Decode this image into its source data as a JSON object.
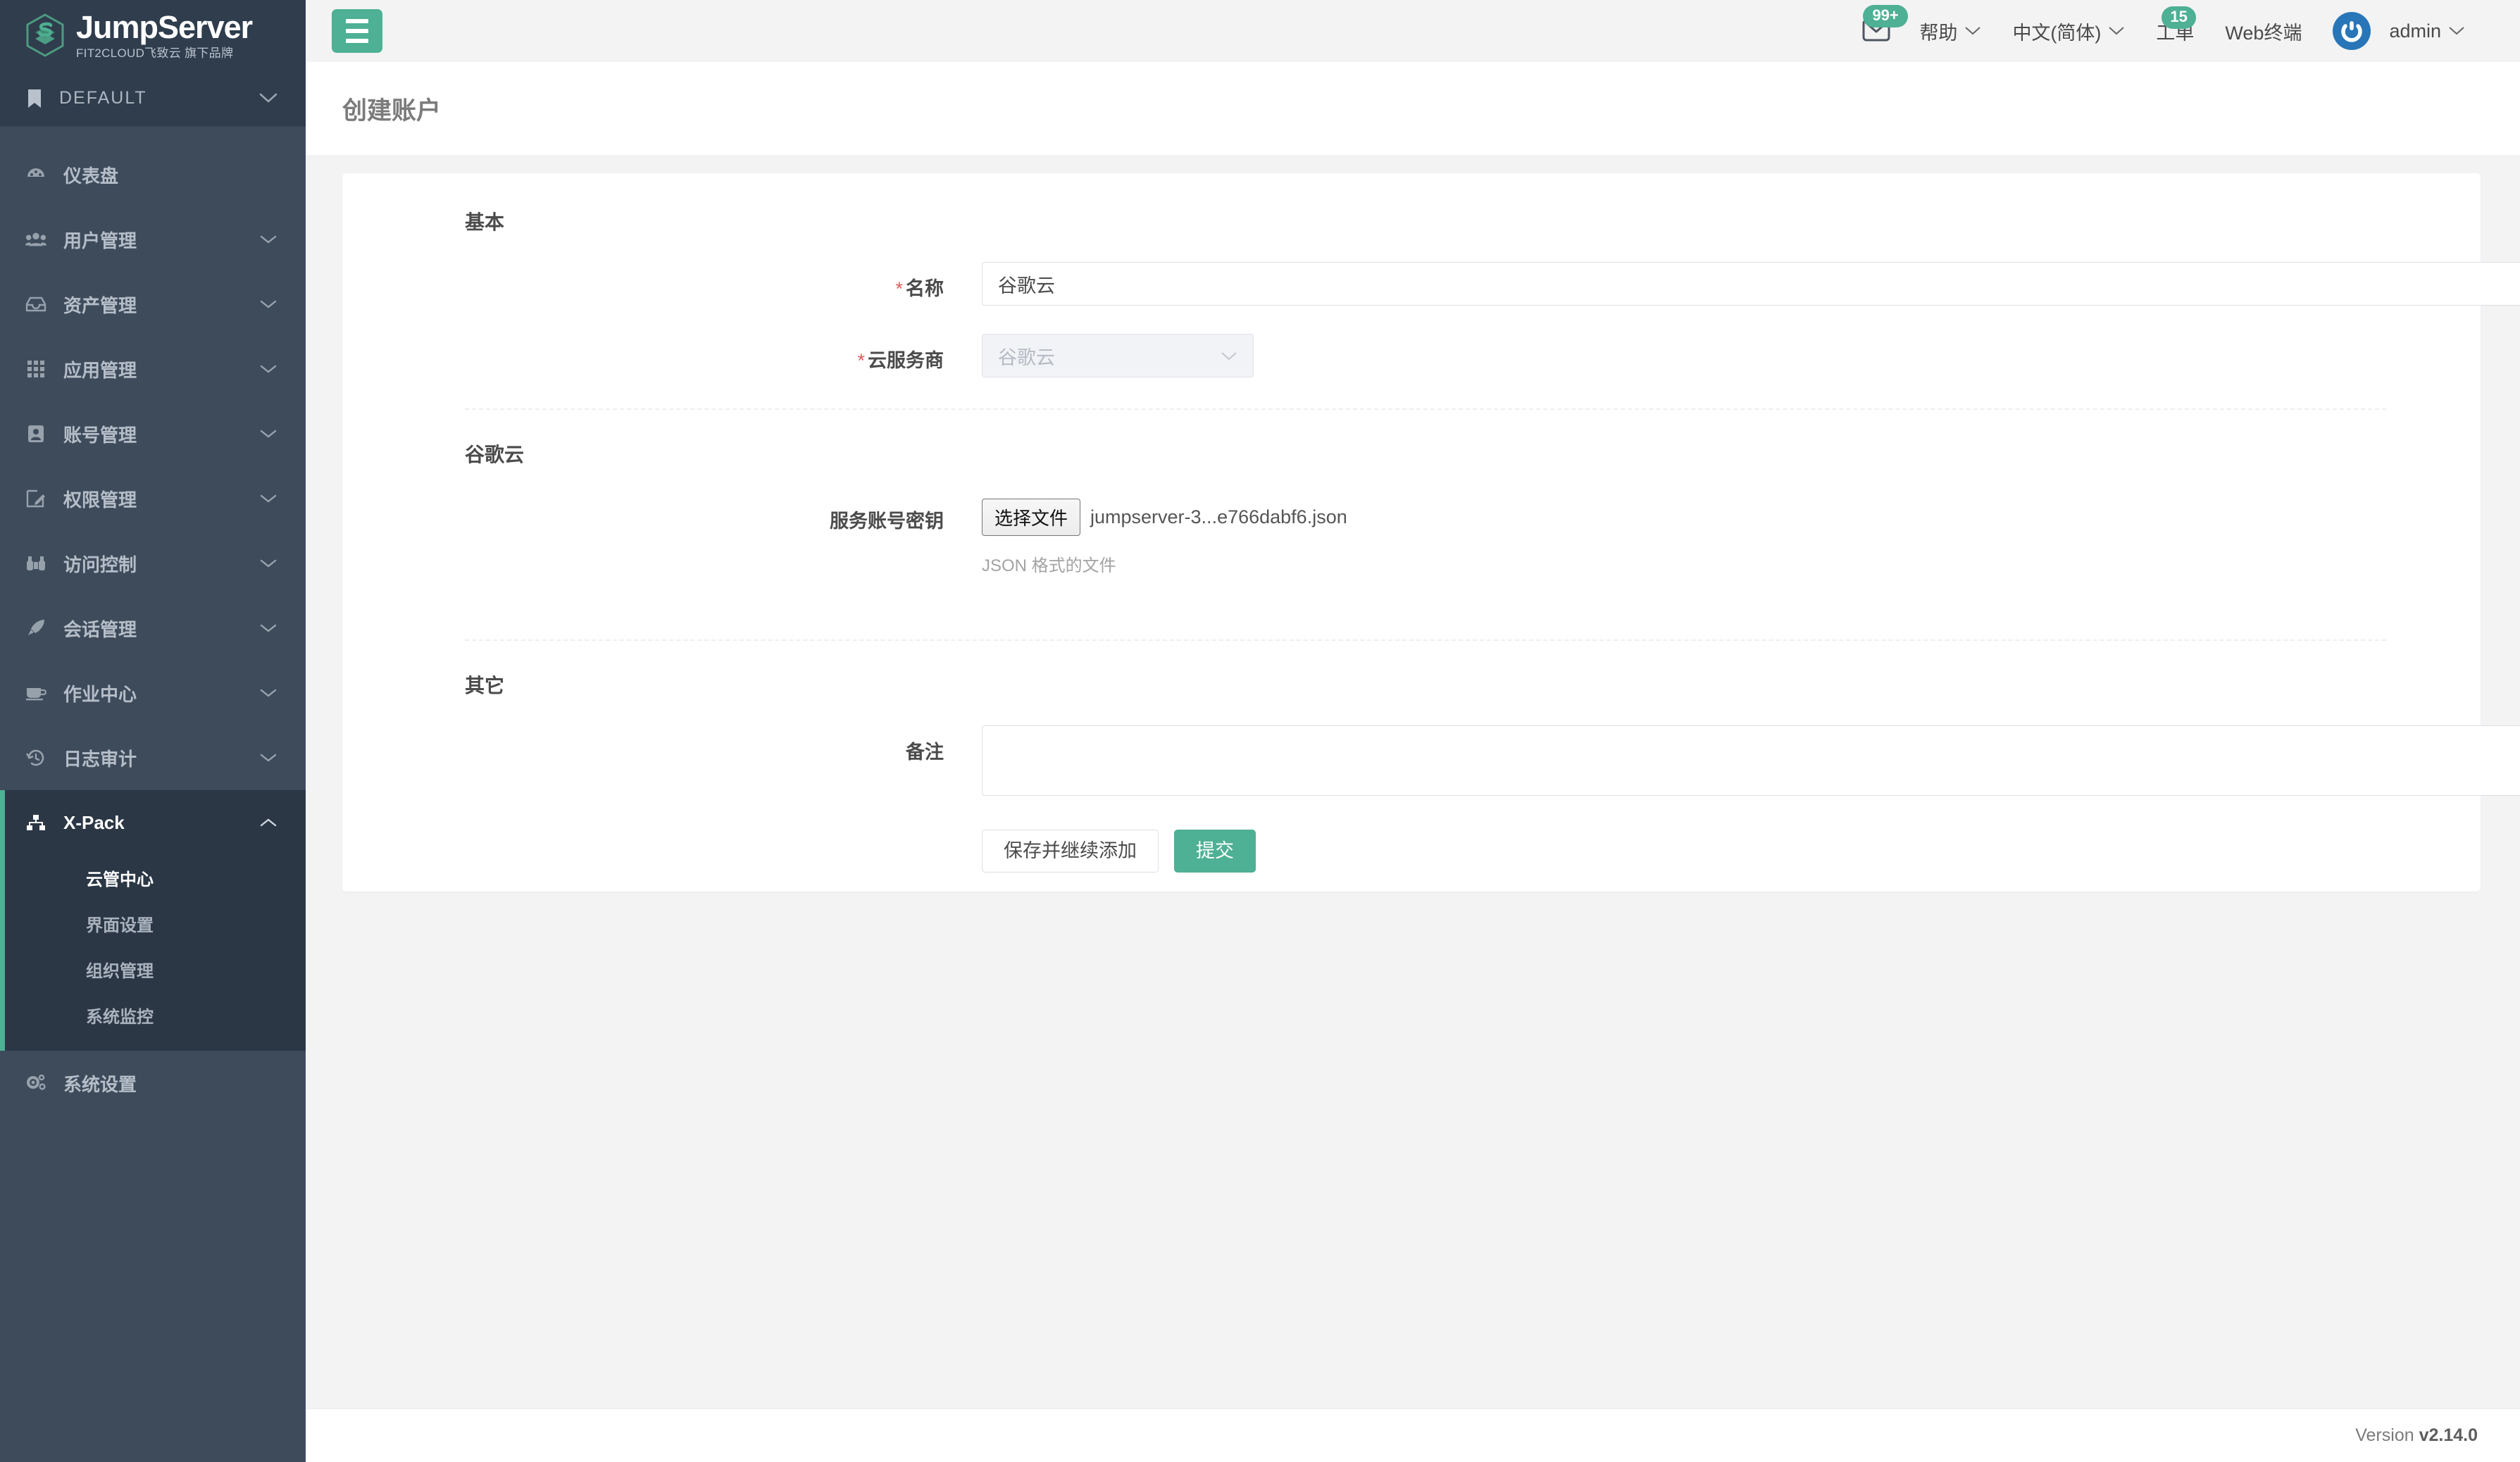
{
  "brand": {
    "name": "JumpServer",
    "subtitle": "FIT2CLOUD飞致云 旗下品牌",
    "logo_icon": "jumpserver-hexagon-logo"
  },
  "sidebar": {
    "org": {
      "label": "DEFAULT",
      "icon": "bookmark-icon",
      "caret": "chevron-down-icon"
    },
    "items": [
      {
        "label": "仪表盘",
        "icon": "dashboard-icon",
        "has_caret": false
      },
      {
        "label": "用户管理",
        "icon": "users-icon",
        "has_caret": true
      },
      {
        "label": "资产管理",
        "icon": "inbox-icon",
        "has_caret": true
      },
      {
        "label": "应用管理",
        "icon": "grid-icon",
        "has_caret": true
      },
      {
        "label": "账号管理",
        "icon": "id-card-icon",
        "has_caret": true
      },
      {
        "label": "权限管理",
        "icon": "edit-square-icon",
        "has_caret": true
      },
      {
        "label": "访问控制",
        "icon": "binoculars-icon",
        "has_caret": true
      },
      {
        "label": "会话管理",
        "icon": "rocket-icon",
        "has_caret": true
      },
      {
        "label": "作业中心",
        "icon": "coffee-icon",
        "has_caret": true
      }
    ],
    "audit": {
      "label": "日志审计",
      "icon": "history-icon",
      "has_caret": true
    },
    "xpack": {
      "label": "X-Pack",
      "icon": "sitemap-icon",
      "caret": "chevron-up-icon",
      "expanded": true,
      "sub_items": [
        {
          "label": "云管中心",
          "current": true
        },
        {
          "label": "界面设置",
          "current": false
        },
        {
          "label": "组织管理",
          "current": false
        },
        {
          "label": "系统监控",
          "current": false
        }
      ]
    },
    "settings": {
      "label": "系统设置",
      "icon": "gears-icon"
    }
  },
  "header": {
    "menu_toggle_icon": "hamburger-icon",
    "mail": {
      "icon": "envelope-icon",
      "badge": "99+"
    },
    "help": {
      "label": "帮助",
      "caret": "chevron-down-icon"
    },
    "language": {
      "label": "中文(简体)",
      "caret": "chevron-down-icon"
    },
    "ticket": {
      "label": "工单",
      "badge": "15"
    },
    "web_terminal": {
      "label": "Web终端"
    },
    "user": {
      "name": "admin",
      "avatar_icon": "power-avatar-icon",
      "caret": "chevron-down-icon"
    }
  },
  "page": {
    "title": "创建账户"
  },
  "form": {
    "basic": {
      "section_title": "基本",
      "name": {
        "label": "名称",
        "required": true,
        "value": "谷歌云",
        "placeholder": ""
      },
      "provider": {
        "label": "云服务商",
        "required": true,
        "value": "谷歌云",
        "disabled": true,
        "caret": "chevron-down-icon"
      }
    },
    "gcp": {
      "section_title": "谷歌云",
      "service_key": {
        "label": "服务账号密钥",
        "button_label": "选择文件",
        "file_name": "jumpserver-3...e766dabf6.json",
        "help_text": "JSON 格式的文件"
      }
    },
    "other": {
      "section_title": "其它",
      "comment": {
        "label": "备注",
        "value": "",
        "placeholder": ""
      }
    },
    "actions": {
      "save_continue_label": "保存并继续添加",
      "submit_label": "提交"
    }
  },
  "footer": {
    "prefix": "Version",
    "version": "v2.14.0"
  },
  "colors": {
    "accent_green": "#4eb094",
    "sidebar_bg": "#3e4b5b",
    "sidebar_dark": "#2b3745",
    "required_red": "#e05c5c",
    "avatar_blue": "#2876b8"
  }
}
